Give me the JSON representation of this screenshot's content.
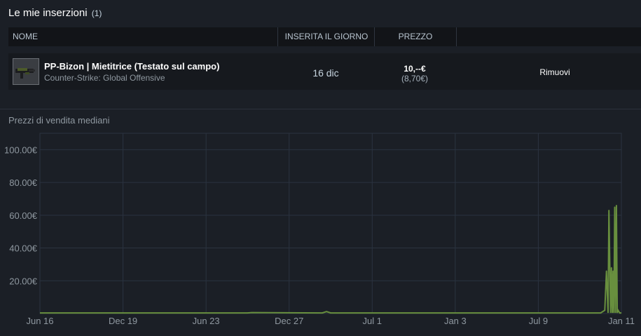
{
  "header": {
    "title": "Le mie inserzioni",
    "count": "(1)"
  },
  "table": {
    "columns": {
      "name": "NOME",
      "date": "INSERITA IL GIORNO",
      "price": "PREZZO"
    },
    "rows": [
      {
        "item_name": "PP-Bizon | Mietitrice (Testato sul campo)",
        "game": "Counter-Strike: Global Offensive",
        "date": "16 dic",
        "price": "10,--€",
        "price_net": "(8,70€)",
        "action": "Rimuovi"
      }
    ]
  },
  "chart_section": {
    "title": "Prezzi di vendita mediani"
  },
  "colors": {
    "line": "#688f3e",
    "grid": "#2b3340",
    "background": "#1b1f26"
  },
  "chart_data": {
    "type": "line",
    "title": "Prezzi di vendita mediani",
    "xlabel": "",
    "ylabel": "",
    "ylim": [
      0,
      110
    ],
    "y_ticks": [
      20,
      40,
      60,
      80,
      100
    ],
    "y_tick_labels": [
      "20.00€",
      "40.00€",
      "60.00€",
      "80.00€",
      "100.00€"
    ],
    "x_tick_labels": [
      "Jun 16",
      "Dec 19",
      "Jun 23",
      "Dec 27",
      "Jul 1",
      "Jan 3",
      "Jul 9",
      "Jan 11"
    ],
    "grid": true,
    "series": [
      {
        "x": [
          0,
          2.5,
          2.55,
          3.4,
          3.45,
          3.5,
          6.5,
          6.75,
          6.8,
          6.82,
          6.84,
          6.85,
          6.87,
          6.88,
          6.89,
          6.9,
          6.91,
          6.92,
          6.93,
          6.94,
          6.95,
          6.96,
          6.98,
          7.0
        ],
        "y": [
          0.4,
          0.4,
          0.6,
          0.4,
          1.2,
          0.4,
          0.4,
          0.4,
          2.0,
          26.0,
          0.4,
          63.0,
          0.4,
          28.0,
          0.4,
          26.0,
          0.4,
          65.0,
          0.4,
          66.0,
          0.4,
          2.0,
          0.4,
          0.4
        ]
      }
    ]
  }
}
